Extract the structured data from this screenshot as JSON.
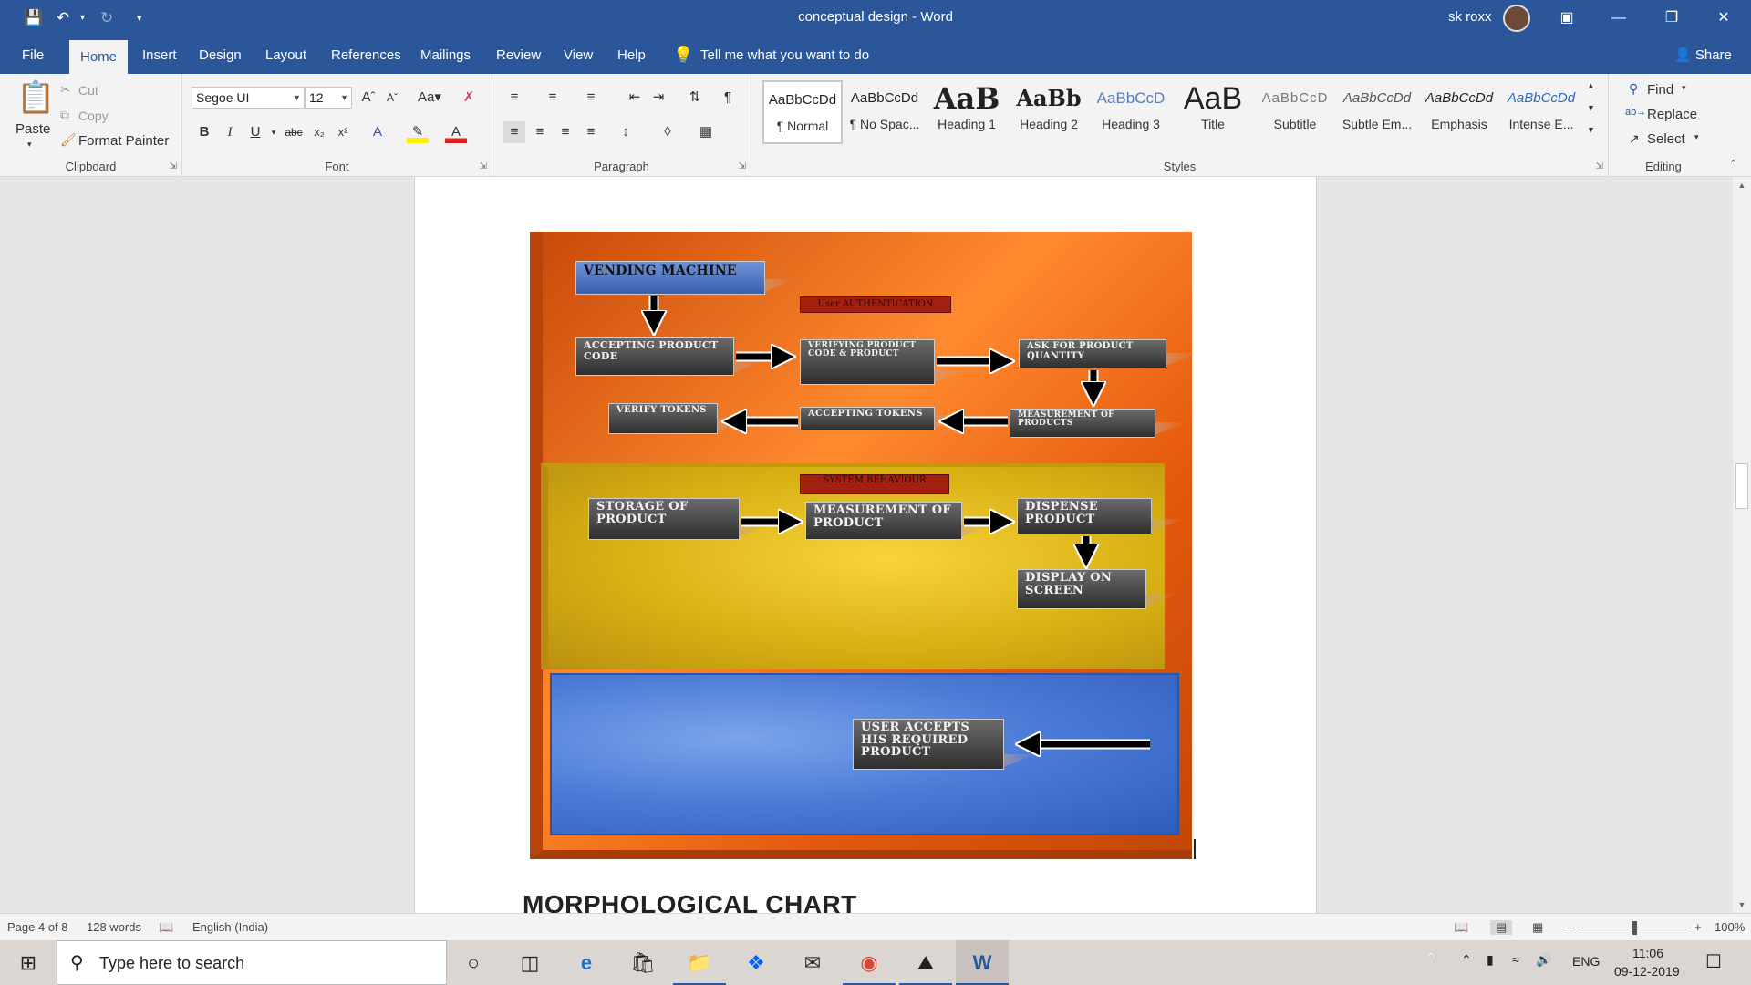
{
  "window": {
    "doc_title": "conceptual design",
    "app_name": "Word",
    "title_sep": "-",
    "user": "sk roxx"
  },
  "tabs": [
    "File",
    "Home",
    "Insert",
    "Design",
    "Layout",
    "References",
    "Mailings",
    "Review",
    "View",
    "Help"
  ],
  "tell_me": "Tell me what you want to do",
  "share": "Share",
  "clipboard": {
    "paste": "Paste",
    "cut": "Cut",
    "copy": "Copy",
    "format_painter": "Format Painter",
    "label": "Clipboard"
  },
  "font": {
    "name": "Segoe UI",
    "size": "12",
    "label": "Font",
    "aa": "Aa"
  },
  "paragraph": {
    "label": "Paragraph"
  },
  "styles": {
    "label": "Styles",
    "items": [
      {
        "sample": "AaBbCcDd",
        "name": "¶ Normal"
      },
      {
        "sample": "AaBbCcDd",
        "name": "¶ No Spac..."
      },
      {
        "sample": "AaB",
        "name": "Heading 1"
      },
      {
        "sample": "AaBb",
        "name": "Heading 2"
      },
      {
        "sample": "AaBbCcD",
        "name": "Heading 3"
      },
      {
        "sample": "AaB",
        "name": "Title"
      },
      {
        "sample": "AaBbCcD",
        "name": "Subtitle"
      },
      {
        "sample": "AaBbCcDd",
        "name": "Subtle Em..."
      },
      {
        "sample": "AaBbCcDd",
        "name": "Emphasis"
      },
      {
        "sample": "AaBbCcDd",
        "name": "Intense E..."
      }
    ]
  },
  "editing": {
    "find": "Find",
    "replace": "Replace",
    "select": "Select",
    "label": "Editing"
  },
  "diagram": {
    "title": "VENDING MACHINE",
    "auth_tag": "User AUTHENTICATION",
    "behaviour_tag": "SYSTEM  BEHAVIOUR",
    "boxes": {
      "accepting_code": "ACCEPTING PRODUCT CODE",
      "verifying": "VERIFYING PRODUCT CODE & PRODUCT",
      "ask_qty": "ASK FOR PRODUCT QUANTITY",
      "measurement_products": "MEASUREMENT OF PRODUCTS",
      "accepting_tokens": "ACCEPTING TOKENS",
      "verify_tokens": "VERIFY TOKENS",
      "storage": "STORAGE OF PRODUCT",
      "measurement_product": "MEASUREMENT OF PRODUCT",
      "dispense": "DISPENSE PRODUCT",
      "display": "DISPLAY ON SCREEN",
      "user_accepts": "USER ACCEPTS HIS REQUIRED PRODUCT"
    },
    "colors": {
      "orange": "#e4580d",
      "yellow": "#d4ad12",
      "blue": "#3f6fcb"
    }
  },
  "next_heading": "MORPHOLOGICAL CHART",
  "status": {
    "page": "Page 4 of 8",
    "words": "128 words",
    "language": "English (India)",
    "zoom": "100%"
  },
  "taskbar": {
    "search_placeholder": "Type here to search",
    "lang": "ENG",
    "time": "11:06",
    "date": "09-12-2019"
  }
}
